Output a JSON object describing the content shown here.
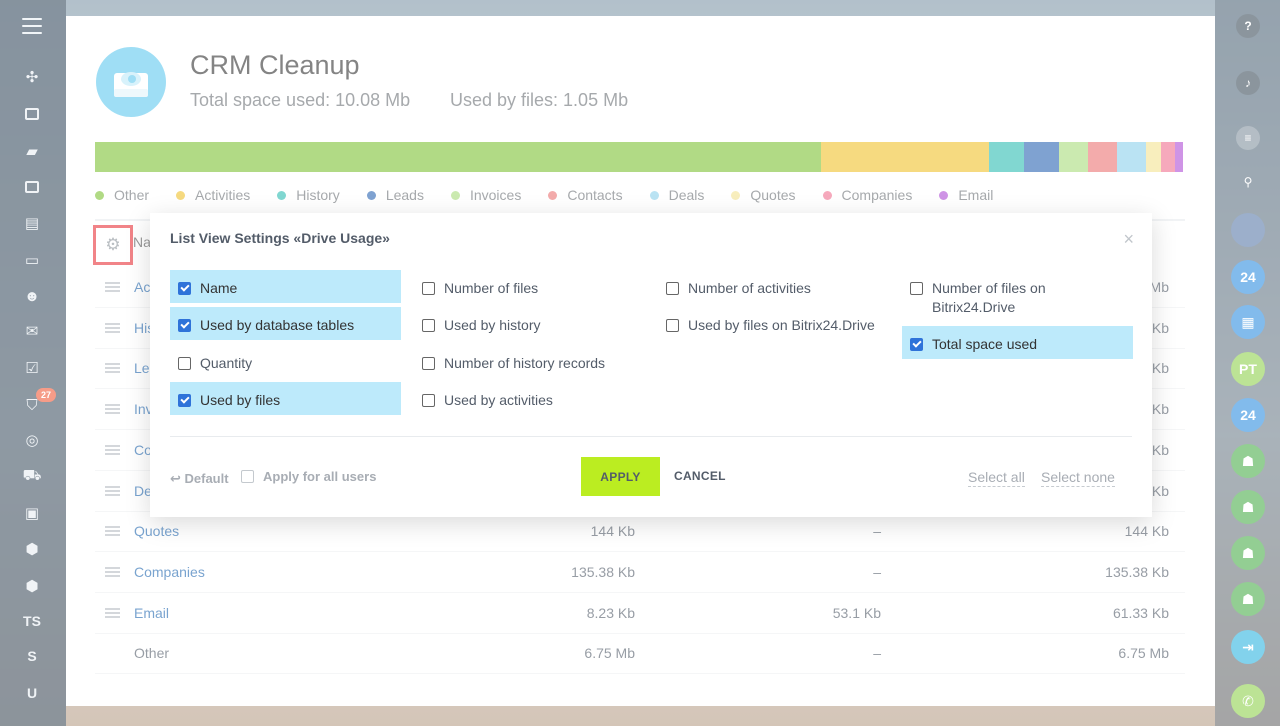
{
  "page": {
    "title": "CRM Cleanup",
    "total_space": "Total space used: 10.08 Mb",
    "used_by_files": "Used by files: 1.05 Mb"
  },
  "usage_segments": [
    {
      "name": "Other",
      "share": 0.666,
      "color": "#7ec234"
    },
    {
      "name": "Activities",
      "share": 0.154,
      "color": "#f0c12c"
    },
    {
      "name": "History",
      "share": 0.032,
      "color": "#2dbcb3"
    },
    {
      "name": "Leads",
      "share": 0.032,
      "color": "#2a65b3"
    },
    {
      "name": "Invoices",
      "share": 0.027,
      "color": "#a9dc7c"
    },
    {
      "name": "Contacts",
      "share": 0.027,
      "color": "#ec7374"
    },
    {
      "name": "Deals",
      "share": 0.026,
      "color": "#8cd1ec"
    },
    {
      "name": "Quotes",
      "share": 0.014,
      "color": "#f4e391"
    },
    {
      "name": "Companies",
      "share": 0.013,
      "color": "#f07090"
    },
    {
      "name": "Email",
      "share": 0.007,
      "color": "#b04ed6"
    }
  ],
  "table": {
    "header_name": "Na",
    "rows": [
      {
        "name": "Ac",
        "c1": "",
        "c2": "",
        "c3": "Mb"
      },
      {
        "name": "His",
        "c1": "",
        "c2": "",
        "c3": "Kb"
      },
      {
        "name": "Le",
        "c1": "",
        "c2": "",
        "c3": "Kb"
      },
      {
        "name": "Inv",
        "c1": "",
        "c2": "",
        "c3": "Kb"
      },
      {
        "name": "Co",
        "c1": "",
        "c2": "",
        "c3": "Kb"
      },
      {
        "name": "De",
        "c1": "",
        "c2": "",
        "c3": "Kb"
      },
      {
        "name": "Quotes",
        "c1": "144 Kb",
        "c2": "–",
        "c3": "144 Kb"
      },
      {
        "name": "Companies",
        "c1": "135.38 Kb",
        "c2": "–",
        "c3": "135.38 Kb"
      },
      {
        "name": "Email",
        "c1": "8.23 Kb",
        "c2": "53.1 Kb",
        "c3": "61.33 Kb"
      },
      {
        "name": "Other",
        "c1": "6.75 Mb",
        "c2": "–",
        "c3": "6.75 Mb"
      }
    ]
  },
  "nav": {
    "badge": "27",
    "text_items": [
      "TS",
      "S",
      "U"
    ]
  },
  "right_bar": {
    "help": "?",
    "avatars": [
      "24",
      "PT",
      "24"
    ]
  },
  "dialog": {
    "title": "List View Settings «Drive Usage»",
    "close": "×",
    "options": [
      {
        "label": "Name",
        "checked": true
      },
      {
        "label": "Used by database tables",
        "checked": true
      },
      {
        "label": "Quantity",
        "checked": false
      },
      {
        "label": "Used by files",
        "checked": true
      },
      {
        "label": "Number of files",
        "checked": false
      },
      {
        "label": "Used by history",
        "checked": false
      },
      {
        "label": "Number of history records",
        "checked": false
      },
      {
        "label": "Used by activities",
        "checked": false
      },
      {
        "label": "Number of activities",
        "checked": false
      },
      {
        "label": "Used by files on Bitrix24.Drive",
        "checked": false
      },
      {
        "label": "Number of files on Bitrix24.Drive",
        "checked": false
      },
      {
        "label": "Total space used",
        "checked": true
      }
    ],
    "footer": {
      "default": "↩ Default",
      "apply_all": "Apply for all users",
      "apply": "APPLY",
      "cancel": "CANCEL",
      "select_all": "Select all",
      "select_none": "Select none"
    }
  }
}
